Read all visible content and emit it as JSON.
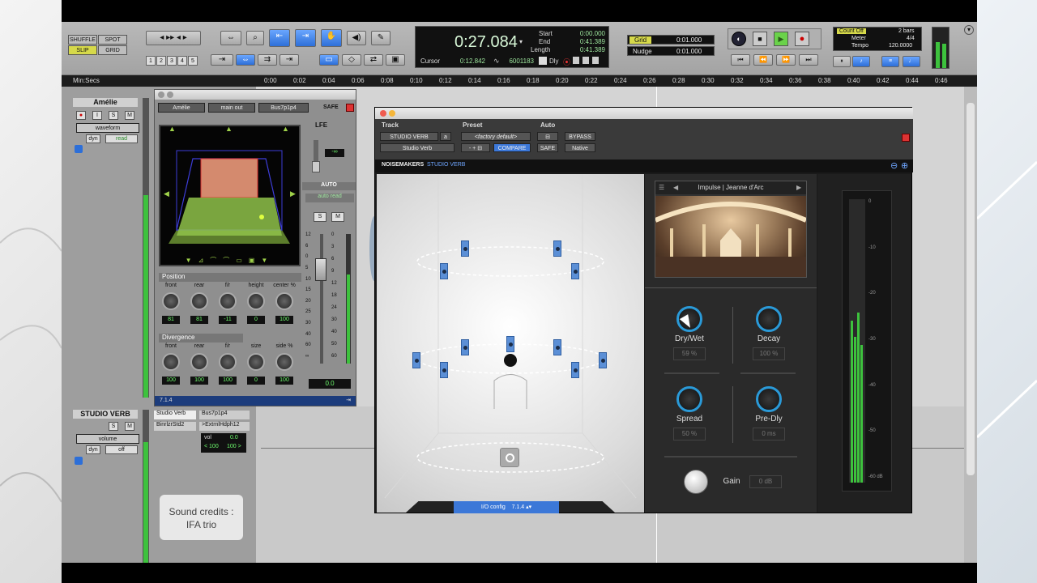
{
  "toolbar": {
    "modes": [
      "SHUFFLE",
      "SPOT",
      "SLIP",
      "GRID"
    ],
    "zoom_presets": [
      "1",
      "2",
      "3",
      "4",
      "5"
    ],
    "counter": {
      "main_time": "0:27.084",
      "start_label": "Start",
      "start_val": "0:00.000",
      "end_label": "End",
      "end_val": "0:41.389",
      "length_label": "Length",
      "length_val": "0:41.389",
      "cursor_label": "Cursor",
      "cursor_val": "0:12.842",
      "samples": "6001183",
      "dly": "Dly"
    },
    "grid_label": "Grid",
    "grid_val": "0:01.000",
    "nudge_label": "Nudge",
    "nudge_val": "0:01.000",
    "count_off": "Count Off",
    "bars": "2 bars",
    "meter_label": "Meter",
    "meter_val": "4/4",
    "tempo_label": "Tempo",
    "tempo_val": "120.0000"
  },
  "ruler": {
    "label": "Min:Secs",
    "ticks": [
      "0:00",
      "0:02",
      "0:04",
      "0:06",
      "0:08",
      "0:10",
      "0:12",
      "0:14",
      "0:16",
      "0:18",
      "0:20",
      "0:22",
      "0:24",
      "0:26",
      "0:28",
      "0:30",
      "0:32",
      "0:34",
      "0:36",
      "0:38",
      "0:40",
      "0:42",
      "0:44",
      "0:46"
    ]
  },
  "track1": {
    "name": "Amélie",
    "view": "waveform",
    "dyn": "dyn",
    "automation": "read",
    "io_label": "7.1.4"
  },
  "track2": {
    "name": "STUDIO VERB",
    "view": "volume",
    "dyn": "dyn",
    "automation": "off",
    "insert": "Studio Verb",
    "insert2": "BinrlzrStd2",
    "output": "Bus7p1p4",
    "send": ">ExtrnlHdph12",
    "vol_label": "vol",
    "vol_val": "0.0",
    "pan_l": "< 100",
    "pan_r": "100 >"
  },
  "panner": {
    "track": "Amélie",
    "output": "main out",
    "bus": "Bus7p1p4",
    "safe": "SAFE",
    "lfe": "LFE",
    "lfe_val": "-∞",
    "auto": "AUTO",
    "auto_mode": "auto read",
    "solo": "S",
    "mute": "M",
    "fader_val": "0.0",
    "position_title": "Position",
    "position_knobs": [
      {
        "label": "front",
        "value": "81"
      },
      {
        "label": "rear",
        "value": "81"
      },
      {
        "label": "f/r",
        "value": "-11"
      },
      {
        "label": "height",
        "value": "0"
      },
      {
        "label": "center %",
        "value": "100"
      }
    ],
    "divergence_title": "Divergence",
    "divergence_knobs": [
      {
        "label": "front",
        "value": "100"
      },
      {
        "label": "rear",
        "value": "100"
      },
      {
        "label": "f/r",
        "value": "100"
      },
      {
        "label": "size",
        "value": "0"
      },
      {
        "label": "side %",
        "value": "100"
      }
    ],
    "fader_scale": [
      "12",
      "6",
      "0",
      "5",
      "10",
      "15",
      "20",
      "25",
      "30",
      "40",
      "60",
      "∞"
    ],
    "meter_scale": [
      "0",
      "3",
      "6",
      "9",
      "12",
      "18",
      "24",
      "30",
      "40",
      "50",
      "60"
    ]
  },
  "plugin": {
    "hdr_track": "Track",
    "hdr_preset": "Preset",
    "hdr_auto": "Auto",
    "track_name": "STUDIO VERB",
    "track_suffix": "a",
    "insert_name": "Studio Verb",
    "preset_name": "<factory default>",
    "compare": "COMPARE",
    "bypass": "BYPASS",
    "safe": "SAFE",
    "native": "Native",
    "brand": "NOISEMAKERS",
    "product": "STUDIO VERB",
    "io_label": "I/O config",
    "io_val": "7.1.4",
    "ir_label": "Impulse",
    "ir_name": "Jeanne d'Arc",
    "knobs": [
      {
        "label": "Dry/Wet",
        "value": "59 %"
      },
      {
        "label": "Decay",
        "value": "100 %"
      },
      {
        "label": "Spread",
        "value": "50 %"
      },
      {
        "label": "Pre-Dly",
        "value": "0 ms"
      }
    ],
    "gain_label": "Gain",
    "gain_val": "0 dB",
    "meter_scale": [
      "0",
      "-10",
      "-20",
      "-30",
      "-40",
      "-50",
      "-60 dB"
    ]
  },
  "credits": {
    "line1": "Sound credits :",
    "line2": "IFA trio"
  },
  "colors": {
    "accent": "#2a9ad8",
    "selected": "#3c78d8",
    "meter_green": "#3dc23d",
    "counter_green": "#9fe89f"
  }
}
